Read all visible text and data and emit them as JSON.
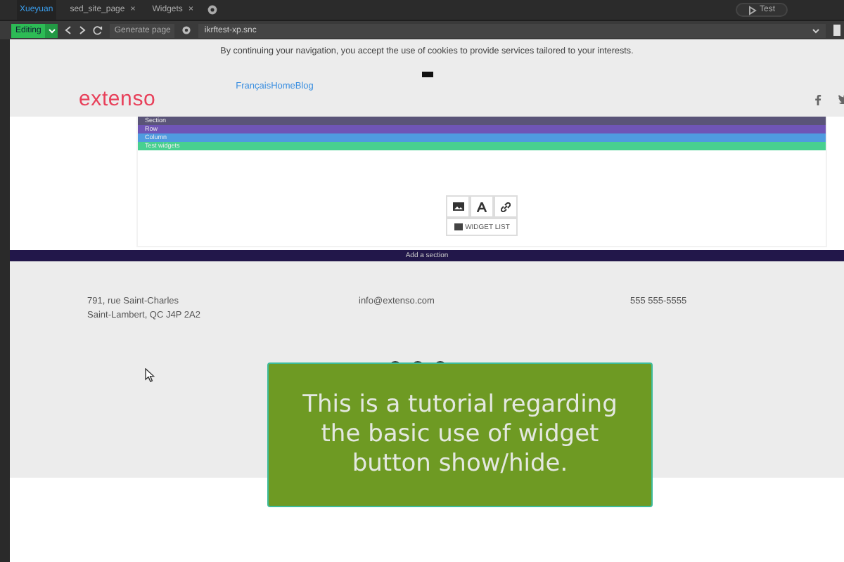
{
  "tabs": [
    {
      "label": "Xueyuan",
      "selected": true,
      "closable": false
    },
    {
      "label": "sed_site_page",
      "selected": false,
      "closable": true
    },
    {
      "label": "Widgets",
      "selected": false,
      "closable": true
    }
  ],
  "close_glyph": "×",
  "test_button": {
    "label": "Test"
  },
  "toolbar": {
    "mode": "Editing",
    "generate": "Generate page",
    "url": "ikrftest-xp.snc"
  },
  "page": {
    "cookie_notice": "By continuing your navigation, you accept the use of cookies to provide services tailored to your interests.",
    "logo": "extenso",
    "nav_link": "FrançaisHomeBlog",
    "editor_bars": [
      {
        "label": "Section",
        "color": "#5a5478"
      },
      {
        "label": "Row",
        "color": "#6f55b6"
      },
      {
        "label": "Column",
        "color": "#4f9be0"
      },
      {
        "label": "Test widgets",
        "color": "#48d090"
      }
    ],
    "widget_list": "WIDGET LIST",
    "add_section": "Add a section",
    "footer": {
      "address": [
        "791, rue Saint-Charles",
        "Saint-Lambert, QC J4P 2A2"
      ],
      "email": "info@extenso.com",
      "phone": "555 555-5555"
    }
  },
  "tutorial": "This is a tutorial regarding the basic use of widget button show/hide."
}
